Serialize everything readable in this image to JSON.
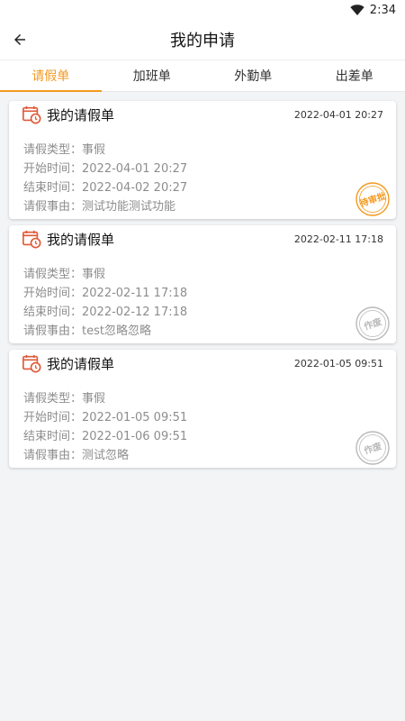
{
  "status_bar": {
    "time": "2:34"
  },
  "app_bar": {
    "title": "我的申请"
  },
  "tabs": [
    {
      "label": "请假单",
      "active": true
    },
    {
      "label": "加班单",
      "active": false
    },
    {
      "label": "外勤单",
      "active": false
    },
    {
      "label": "出差单",
      "active": false
    }
  ],
  "cards": [
    {
      "title": "我的请假单",
      "created": "2022-04-01 20:27",
      "fields": [
        "请假类型：事假",
        "开始时间：2022-04-01 20:27",
        "结束时间：2022-04-02 20:27",
        "请假事由：测试功能测试功能"
      ],
      "stamp": {
        "text": "待审批",
        "color": "#f39a1f"
      }
    },
    {
      "title": "我的请假单",
      "created": "2022-02-11 17:18",
      "fields": [
        "请假类型：事假",
        "开始时间：2022-02-11 17:18",
        "结束时间：2022-02-12 17:18",
        "请假事由：test忽略忽略"
      ],
      "stamp": {
        "text": "作废",
        "color": "#b9b9b9"
      }
    },
    {
      "title": "我的请假单",
      "created": "2022-01-05 09:51",
      "fields": [
        "请假类型：事假",
        "开始时间：2022-01-05 09:51",
        "结束时间：2022-01-06 09:51",
        "请假事由：测试忽略"
      ],
      "stamp": {
        "text": "作废",
        "color": "#b9b9b9"
      }
    }
  ],
  "colors": {
    "accent": "#f39a1f",
    "icon_red": "#e05a3a"
  },
  "icons": {
    "wifi": "wifi-icon",
    "back": "arrow-left-icon",
    "card": "calendar-clock-icon"
  }
}
